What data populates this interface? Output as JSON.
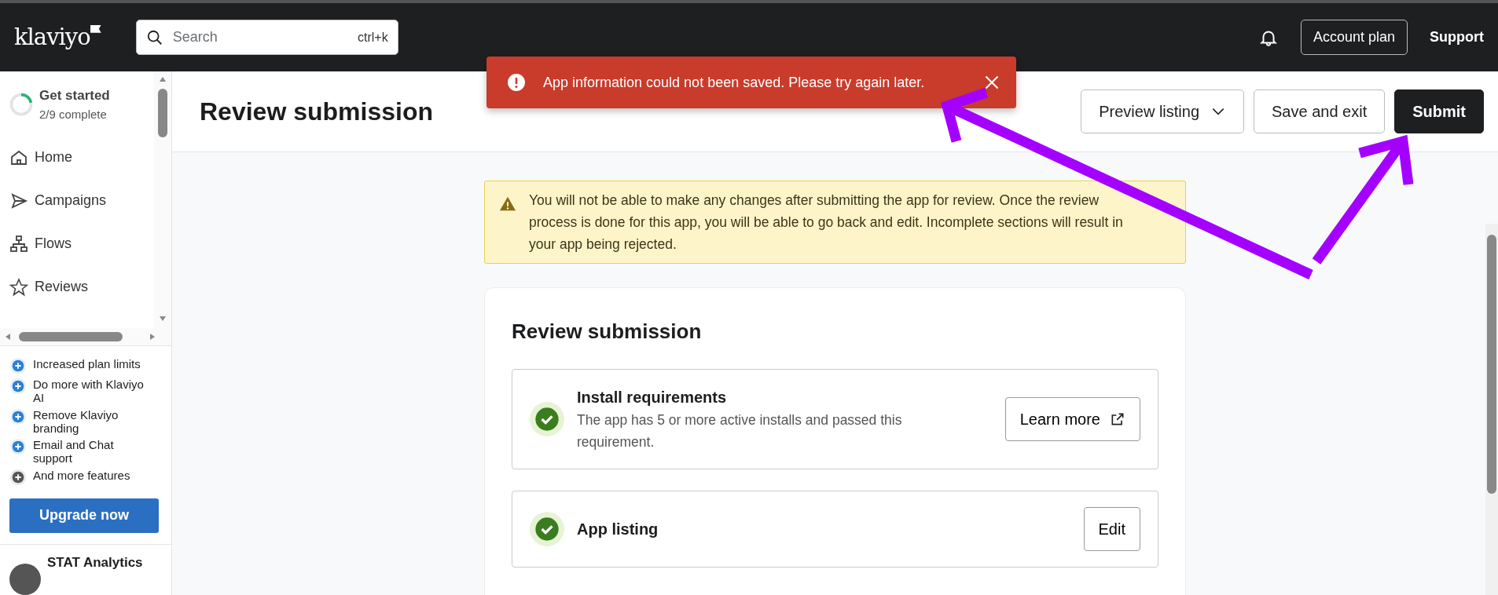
{
  "header": {
    "logo": "klaviyo",
    "search": {
      "placeholder": "Search",
      "shortcut": "ctrl+k"
    },
    "account_button": "Account plan",
    "support_link": "Support"
  },
  "toast": {
    "kind": "error",
    "message": "App information could not been saved. Please try again later."
  },
  "sidebar": {
    "get_started": {
      "title": "Get started",
      "progress": "2/9 complete",
      "level": 0.22
    },
    "nav": [
      {
        "label": "Home",
        "kind": "home"
      },
      {
        "label": "Campaigns",
        "kind": "campaigns"
      },
      {
        "label": "Flows",
        "kind": "flows"
      },
      {
        "label": "Reviews",
        "kind": "reviews"
      }
    ],
    "upgrade_features": [
      {
        "label": "Increased plan limits",
        "color": "#2c7fd6"
      },
      {
        "label": "Do more with Klaviyo AI",
        "color": "#2c7fd6"
      },
      {
        "label": "Remove Klaviyo branding",
        "color": "#2c7fd6"
      },
      {
        "label": "Email and Chat support",
        "color": "#2c7fd6"
      },
      {
        "label": "And more features",
        "color": "#555555"
      }
    ],
    "upgrade_button": "Upgrade now",
    "account_name": "STAT Analytics"
  },
  "page": {
    "title": "Review submission",
    "actions": [
      {
        "label": "Preview listing",
        "kind": "dropdown"
      },
      {
        "label": "Save and exit",
        "kind": "outline"
      },
      {
        "label": "Submit",
        "kind": "primary"
      }
    ],
    "warning": "You will not be able to make any changes after submitting the app for review. Once the review process is done for this app, you will be able to go back and edit. Incomplete sections will result in your app being rejected.",
    "card": {
      "title": "Review submission",
      "items": [
        {
          "title": "Install requirements",
          "description": "The app has 5 or more active installs and passed this requirement.",
          "done": true,
          "action": {
            "label": "Learn more",
            "external": true
          }
        },
        {
          "title": "App listing",
          "done": true,
          "action": {
            "label": "Edit",
            "external": false
          }
        }
      ]
    }
  }
}
